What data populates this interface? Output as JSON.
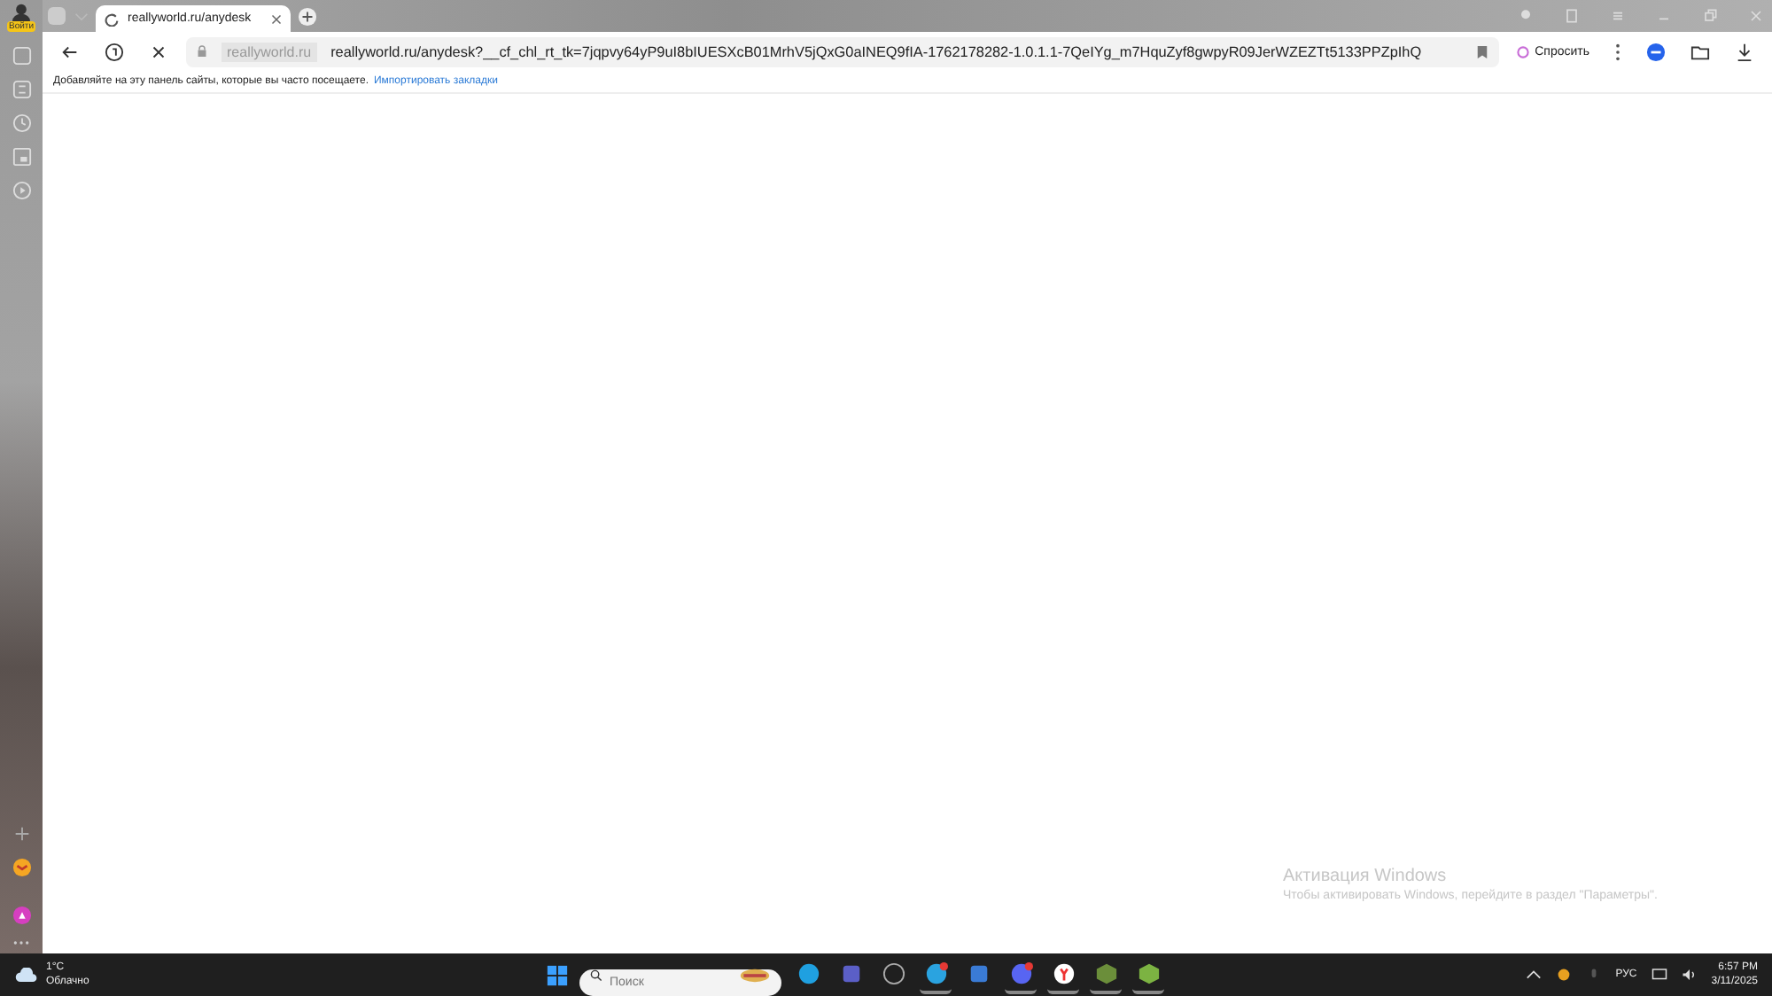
{
  "profile": {
    "label": "Войти"
  },
  "tabs": [
    {
      "title": "reallyworld.ru/anydesk",
      "selected": true,
      "loading": true
    }
  ],
  "address_bar": {
    "domain": "reallyworld.ru",
    "url": "reallyworld.ru/anydesk?__cf_chl_rt_tk=7jqpvy64yP9uI8bIUESXcB01MrhV5jQxG0aINEQ9fIA-1762178282-1.0.1.1-7QeIYg_m7HquZyf8gwpyR09JerWZEZTt5133PPZpIhQ"
  },
  "ask_button": {
    "label": "Спросить"
  },
  "bookmarks_bar": {
    "hint": "Добавляйте на эту панель сайты, которые вы часто посещаете.",
    "link": "Импортировать закладки"
  },
  "activation": {
    "title": "Активация Windows",
    "text": "Чтобы активировать Windows, перейдите в раздел \"Параметры\"."
  },
  "taskbar": {
    "weather": {
      "temp": "1°C",
      "condition": "Облачно"
    },
    "search": {
      "placeholder": "Поиск"
    },
    "apps": [
      {
        "kind": "edge",
        "badge": false,
        "running": false
      },
      {
        "kind": "teams",
        "badge": false,
        "running": false
      },
      {
        "kind": "steam",
        "badge": false,
        "running": false
      },
      {
        "kind": "telegram",
        "badge": true,
        "running": true
      },
      {
        "kind": "calc",
        "badge": false,
        "running": false
      },
      {
        "kind": "discord",
        "badge": true,
        "running": true
      },
      {
        "kind": "yandex",
        "badge": false,
        "running": true
      },
      {
        "kind": "block",
        "badge": false,
        "running": true
      },
      {
        "kind": "block2",
        "badge": false,
        "running": true
      }
    ],
    "language": "РУС",
    "time": "6:57 PM",
    "date": "3/11/2025"
  }
}
